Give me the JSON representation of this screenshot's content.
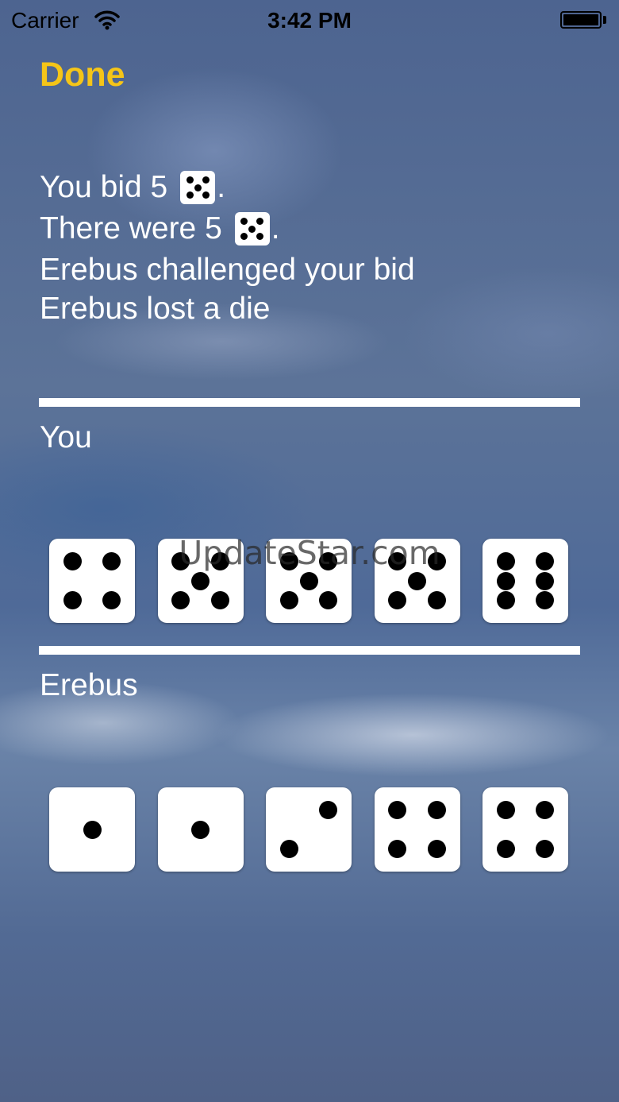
{
  "status_bar": {
    "carrier": "Carrier",
    "time": "3:42 PM",
    "wifi_icon": "wifi-icon",
    "battery_icon": "battery-icon"
  },
  "nav": {
    "done_label": "Done"
  },
  "result": {
    "bid_text": "You bid 5",
    "bid_face": 5,
    "actual_text": "There were 5",
    "actual_face": 5,
    "challenge_text": "Erebus challenged your bid",
    "outcome_text": "Erebus lost a die"
  },
  "players": [
    {
      "name": "You",
      "dice": [
        4,
        5,
        5,
        5,
        6
      ]
    },
    {
      "name": "Erebus",
      "dice": [
        1,
        1,
        2,
        4,
        4
      ]
    }
  ],
  "watermark": "UpdateStar.com",
  "colors": {
    "accent": "#f5c518",
    "text": "#ffffff",
    "die_face": "#ffffff",
    "pip": "#000000"
  }
}
